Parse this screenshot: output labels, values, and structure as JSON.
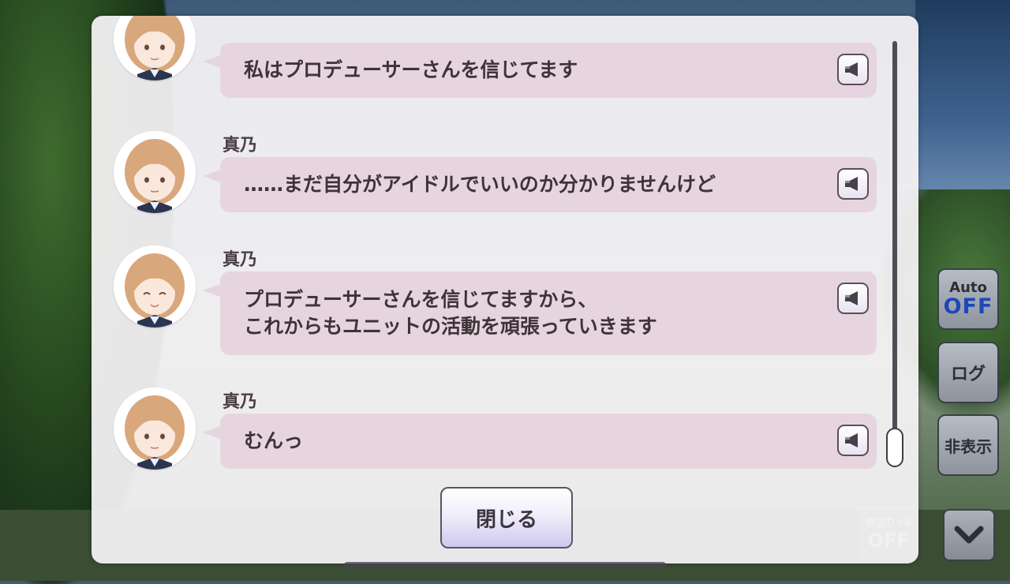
{
  "log": {
    "entries": [
      {
        "speaker": "",
        "lines": [
          "私はプロデューサーさんを信じてます"
        ],
        "voice_icon": "speaker-icon"
      },
      {
        "speaker": "真乃",
        "lines": [
          "……まだ自分がアイドルでいいのか分かりませんけど"
        ],
        "voice_icon": "speaker-icon"
      },
      {
        "speaker": "真乃",
        "lines": [
          "プロデューサーさんを信じてますから、",
          "これからもユニットの活動を頑張っていきます"
        ],
        "voice_icon": "speaker-icon"
      },
      {
        "speaker": "真乃",
        "lines": [
          "むんっ"
        ],
        "voice_icon": "speaker-icon"
      }
    ],
    "close_label": "閉じる",
    "scroll_position": 1.0
  },
  "side_controls": {
    "auto_label": "Auto",
    "auto_state": "OFF",
    "log_label": "ログ",
    "hide_label": "非表示",
    "fast_forward_label": "早送り×4",
    "fast_forward_state": "OFF",
    "scroll_down_icon": "chevron-down-icon"
  },
  "colors": {
    "bubble": "#e6d5df",
    "panel": "#f6f4f6",
    "auto_off": "#1f47b8"
  }
}
